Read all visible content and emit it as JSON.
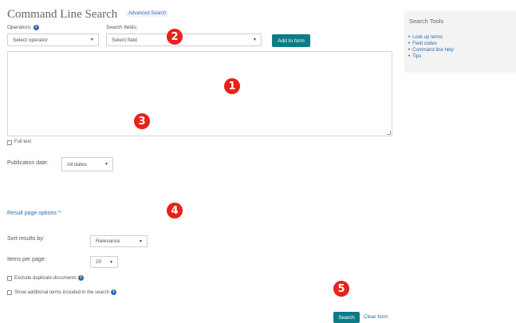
{
  "header": {
    "title": "Command Line Search",
    "advanced_link": "Advanced Search"
  },
  "operators": {
    "label": "Operators:",
    "selected": "Select operator"
  },
  "fields": {
    "label": "Search fields:",
    "selected": "Select field"
  },
  "add_button": "Add to form",
  "full_text": {
    "label": "Full text",
    "checked": false
  },
  "publication_date": {
    "label": "Publication date:",
    "selected": "All dates"
  },
  "result_options": {
    "toggle": "Result page options",
    "toggle_icon": "chevron-up-icon",
    "sort_label": "Sort results by:",
    "sort_selected": "Relevance",
    "items_label": "Items per page:",
    "items_selected": "20",
    "exclude_duplicates": "Exclude duplicate documents",
    "show_additional": "Show additional terms included in the search"
  },
  "actions": {
    "search": "Search",
    "clear": "Clear form"
  },
  "markers": [
    "1",
    "2",
    "3",
    "4",
    "5"
  ],
  "sidebar": {
    "title": "Search Tools",
    "items": [
      "Look up terms",
      "Field codes",
      "Command line help",
      "Tips"
    ]
  },
  "colors": {
    "accent": "#0e7c86",
    "link": "#2b6cb0",
    "marker": "#e8221b",
    "panel_bg": "#f3f3f3"
  }
}
